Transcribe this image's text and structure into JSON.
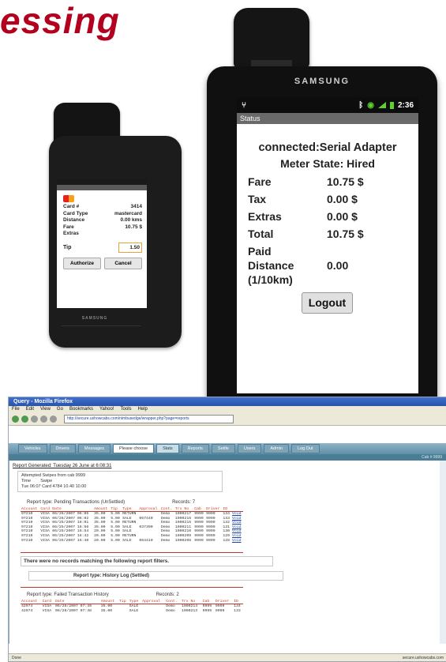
{
  "headline": "essing",
  "phone": {
    "rows": [
      {
        "label": "Card #",
        "value": "3414"
      },
      {
        "label": "Card Type",
        "value": "mastercard"
      },
      {
        "label": "Distance",
        "value": "0.00 kms"
      },
      {
        "label": "Fare",
        "value": "10.75 $"
      },
      {
        "label": "Extras",
        "value": ""
      }
    ],
    "tip_label": "Tip",
    "tip_value": "1.50",
    "authorize_label": "Authorize",
    "cancel_label": "Cancel",
    "brand": "SAMSUNG"
  },
  "tablet": {
    "brand": "SAMSUNG",
    "time": "2:36",
    "title": "Status",
    "connection": "connected:Serial Adapter",
    "meter_state": "Meter State: Hired",
    "fields": [
      {
        "label": "Fare",
        "value": "10.75 $"
      },
      {
        "label": "Tax",
        "value": "0.00 $"
      },
      {
        "label": "Extras",
        "value": "0.00 $"
      },
      {
        "label": "Total",
        "value": "10.75 $"
      },
      {
        "label": "Paid\nDistance\n(1/10km)",
        "value": "0.00"
      }
    ],
    "logout_label": "Logout",
    "colors": {
      "signal": "#5fd12a",
      "titlebar": "#6a6a6a"
    }
  },
  "browser": {
    "window_title": "Query - Mozilla Firefox",
    "menu": [
      "File",
      "Edit",
      "View",
      "Go",
      "Bookmarks",
      "Yahoo!",
      "Tools",
      "Help"
    ],
    "url": "http://secure.ushowcabs.com/nimbusedge/wrapper.php?page=reports",
    "tabs": [
      "Vehicles",
      "Drivers",
      "Messages",
      "Please choose",
      "Stats",
      "Reports",
      "Settle",
      "Users",
      "Admin",
      "Log Out"
    ],
    "user_link": "Cab # 9999",
    "report_generated": "Report Generated: Tuesday 26 June at 6:08:31",
    "attempted": [
      "Attempted Swipes from cab 9999",
      "Time        Swipe",
      "Tue 06:07 Card 4784 10.40 10.00"
    ],
    "pending_label": "Report type:  Pending Transactions (UnSettled)",
    "pending_records": "Records: 7",
    "table_headers": [
      "Account",
      "Card",
      "Date",
      "Amount",
      "Tip",
      "Type",
      "Approval",
      "Cont.",
      "Trx No",
      "Cab",
      "Driver",
      "ID",
      ""
    ],
    "pending_rows": [
      [
        "97210",
        "VISA",
        "06/26/2007 06:05",
        "35.00",
        "5.00",
        "RETURN",
        "",
        "Demo",
        "1000217",
        "9999",
        "9999",
        "134",
        "Void"
      ],
      [
        "97210",
        "VISA",
        "06/26/2007 06:02",
        "35.00",
        "5.00",
        "SALE",
        "067440",
        "Demo",
        "1000216",
        "9999",
        "9999",
        "133",
        "Void"
      ],
      [
        "97210",
        "VISA",
        "06/25/2007 16:01",
        "35.00",
        "5.00",
        "RETURN",
        "",
        "Demo",
        "1000215",
        "9999",
        "9999",
        "132",
        "Void"
      ],
      [
        "97210",
        "VISA",
        "06/25/2007 16:56",
        "35.00",
        "5.00",
        "SALE",
        "037390",
        "Demo",
        "1000211",
        "9999",
        "9999",
        "131",
        "Void"
      ],
      [
        "97210",
        "VISA",
        "06/25/2007 16:54",
        "20.00",
        "5.00",
        "SALE",
        "",
        "Demo",
        "1000210",
        "9999",
        "9999",
        "130",
        "Void"
      ],
      [
        "97210",
        "VISA",
        "06/25/2007 16:42",
        "20.00",
        "5.00",
        "RETURN",
        "",
        "Demo",
        "1000209",
        "9999",
        "9999",
        "129",
        "Void"
      ],
      [
        "97210",
        "VISA",
        "06/25/2007 16:40",
        "20.00",
        "5.00",
        "SALE",
        "064410",
        "Demo",
        "1000208",
        "9999",
        "9999",
        "128",
        "Void"
      ]
    ],
    "no_match": "There were no records matching the following report filters.",
    "history_label": "Report type:  History Log (Settled)",
    "failed_label": "Report type:  Failed Transaction History",
    "failed_records": "Records: 2",
    "failed_headers": [
      "Account",
      "Card",
      "Date",
      "Amount",
      "Tip",
      "Type",
      "Approval",
      "Cont.",
      "Trx No",
      "Cab",
      "Driver",
      "ID"
    ],
    "failed_rows": [
      [
        "42974",
        "VISA",
        "06/26/2007 07:49",
        "35.00",
        "",
        "SALE",
        "",
        "Demo",
        "1000214",
        "9999",
        "9999",
        "134"
      ],
      [
        "42974",
        "VISA",
        "06/26/2007 07:48",
        "35.00",
        "",
        "SALE",
        "",
        "Demo",
        "1000213",
        "9999",
        "9999",
        "133"
      ]
    ],
    "status_left": "Done",
    "status_right": "secure.ushowcabs.com"
  }
}
